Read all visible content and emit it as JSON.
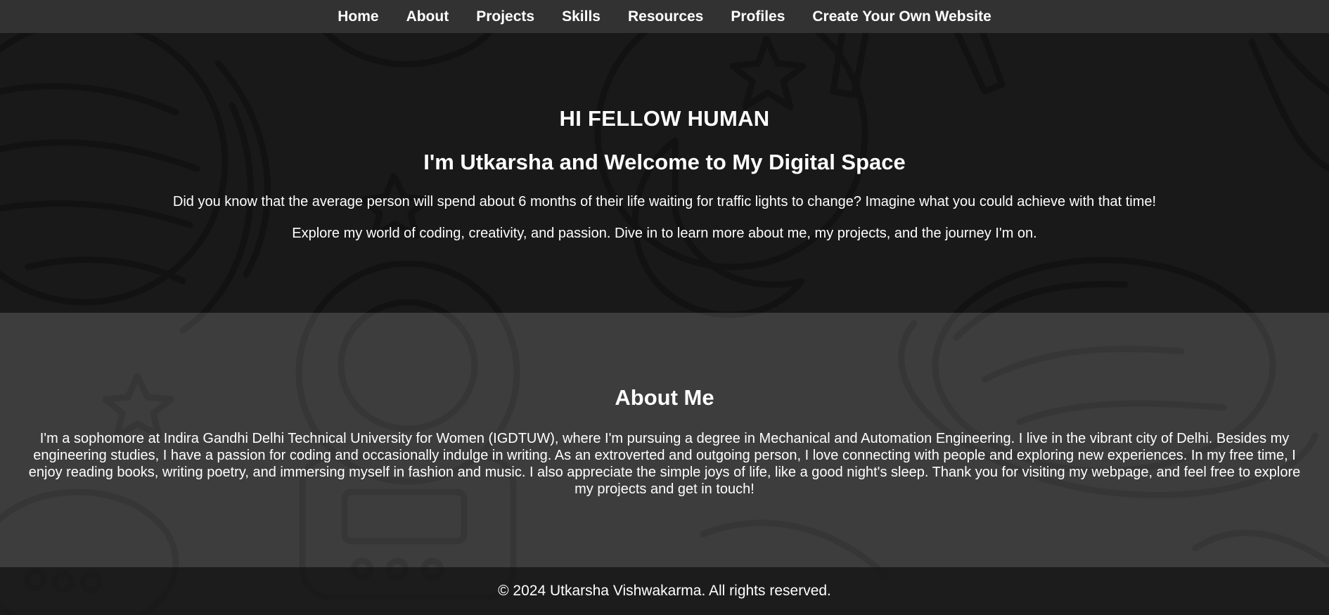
{
  "nav": {
    "items": [
      "Home",
      "About",
      "Projects",
      "Skills",
      "Resources",
      "Profiles",
      "Create Your Own Website"
    ]
  },
  "hero": {
    "greeting": "HI FELLOW HUMAN",
    "welcome": "I'm Utkarsha and Welcome to My Digital Space",
    "fact": "Did you know that the average person will spend about 6 months of their life waiting for traffic lights to change? Imagine what you could achieve with that time!",
    "intro": "Explore my world of coding, creativity, and passion. Dive in to learn more about me, my projects, and the journey I'm on."
  },
  "about": {
    "heading": "About Me",
    "body": "I'm a sophomore at Indira Gandhi Delhi Technical University for Women (IGDTUW), where I'm pursuing a degree in Mechanical and Automation Engineering. I live in the vibrant city of Delhi. Besides my engineering studies, I have a passion for coding and occasionally indulge in writing. As an extroverted and outgoing person, I love connecting with people and exploring new experiences. In my free time, I enjoy reading books, writing poetry, and immersing myself in fashion and music. I also appreciate the simple joys of life, like a good night's sleep. Thank you for visiting my webpage, and feel free to explore my projects and get in touch!"
  },
  "footer": {
    "copyright": "© 2024 Utkarsha Vishwakarma. All rights reserved."
  },
  "theme": {
    "background": "#1c1c1c",
    "nav_bg": "#343434",
    "text": "#ffffff",
    "background_icons": [
      "planet-illustration",
      "astronaut-illustration",
      "moon-illustration",
      "star-illustration",
      "rocket-illustration"
    ]
  }
}
